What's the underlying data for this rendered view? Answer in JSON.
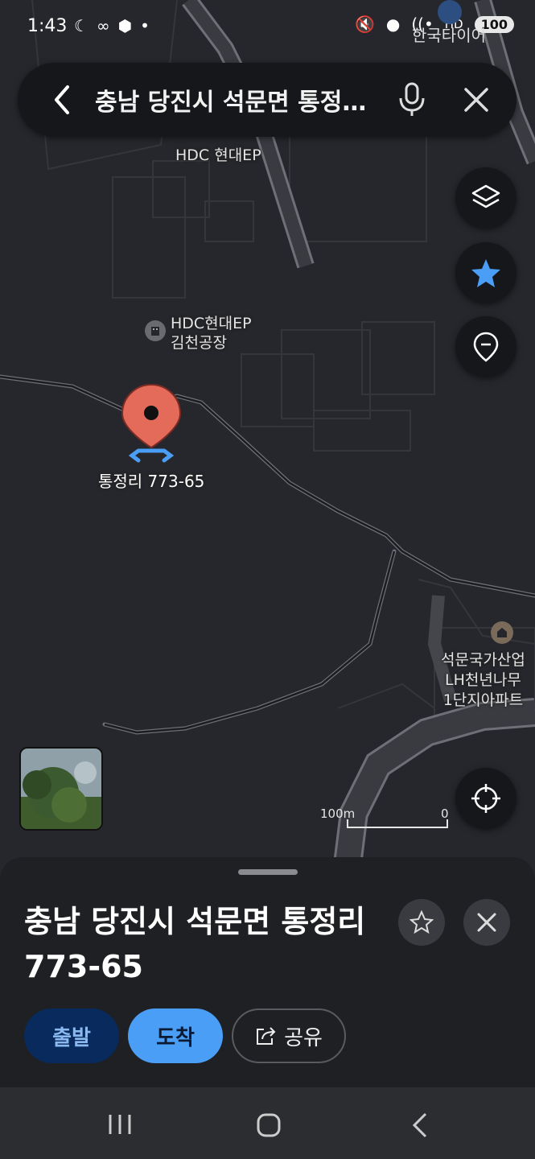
{
  "status_bar": {
    "time": "1:43",
    "battery": "100",
    "network": "HD",
    "carrier_overlay": "한국타이어"
  },
  "search": {
    "query": "충남 당진시 석문면 통정..."
  },
  "map": {
    "labels": {
      "hdc_top": "HDC 현대EP",
      "hdc_factory_line1": "HDC현대EP",
      "hdc_factory_line2": "김천공장",
      "pin_label": "통정리 773-65",
      "apt_line1": "석문국가산업",
      "apt_line2": "LH천년나무",
      "apt_line3": "1단지아파트"
    },
    "scale": {
      "left": "100m",
      "right": "0"
    }
  },
  "sheet": {
    "title": "충남 당진시 석문면 통정리 773-65",
    "depart_label": "출발",
    "arrive_label": "도착",
    "share_label": "공유"
  },
  "colors": {
    "accent": "#4a9ef5",
    "pin": "#e46a5a",
    "depart_bg": "#082a5c",
    "depart_fg": "#8ab8f0"
  }
}
